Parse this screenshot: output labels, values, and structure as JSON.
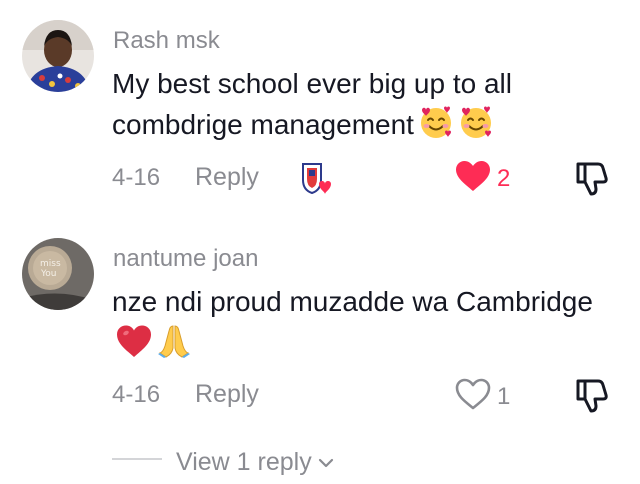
{
  "comments": [
    {
      "username": "Rash msk",
      "text": "My best school ever big up to all combdrige management",
      "emojis": [
        "smiling-face-with-hearts",
        "smiling-face-with-hearts"
      ],
      "date": "4-16",
      "reply_label": "Reply",
      "liked": true,
      "like_count": "2",
      "creator_liked_badge": true
    },
    {
      "username": "nantume joan",
      "text": "nze ndi proud muzadde wa Cambridge",
      "emojis": [
        "red-heart",
        "folded-hands"
      ],
      "date": "4-16",
      "reply_label": "Reply",
      "liked": false,
      "like_count": "1",
      "creator_liked_badge": false
    }
  ],
  "view_replies_label": "View 1 reply",
  "colors": {
    "like_active": "#fe2c55",
    "text_secondary": "#8a8b91",
    "text_primary": "#161823"
  }
}
